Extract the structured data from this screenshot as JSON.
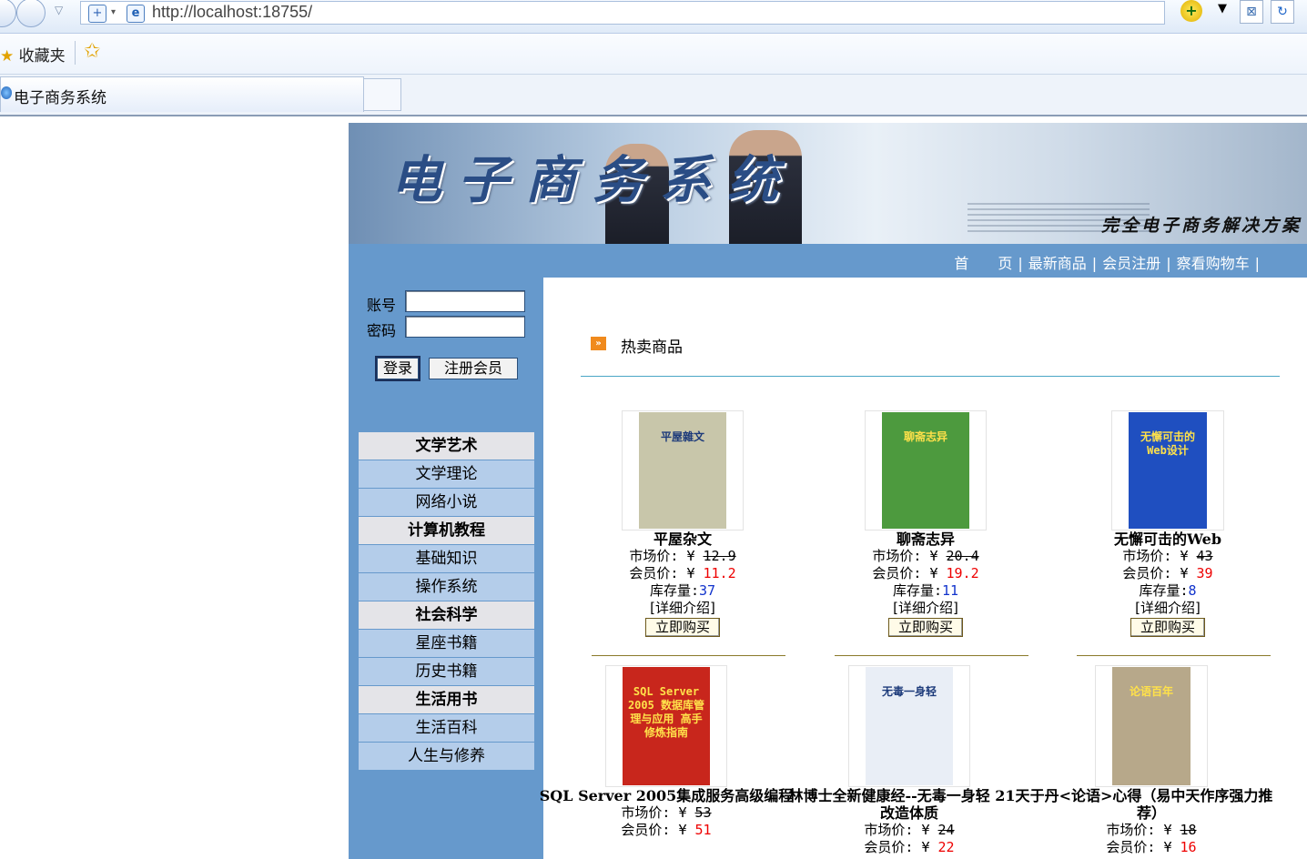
{
  "browser": {
    "url": "http://localhost:18755/",
    "favorites_label": "收藏夹",
    "tab_title": "电子商务系统"
  },
  "banner": {
    "title": "电子商务系统",
    "slogan": "完全电子商务解决方案"
  },
  "nav": {
    "items": [
      "首　　页",
      "最新商品",
      "会员注册",
      "察看购物车"
    ],
    "separator": "|"
  },
  "login": {
    "account_label": "账号",
    "password_label": "密码",
    "login_button": "登录",
    "register_button": "注册会员"
  },
  "categories": [
    {
      "label": "文学艺术",
      "type": "head"
    },
    {
      "label": "文学理论",
      "type": "sub"
    },
    {
      "label": "网络小说",
      "type": "sub"
    },
    {
      "label": "计算机教程",
      "type": "head"
    },
    {
      "label": "基础知识",
      "type": "sub"
    },
    {
      "label": "操作系统",
      "type": "sub"
    },
    {
      "label": "社会科学",
      "type": "head"
    },
    {
      "label": "星座书籍",
      "type": "sub"
    },
    {
      "label": "历史书籍",
      "type": "sub"
    },
    {
      "label": "生活用书",
      "type": "head"
    },
    {
      "label": "生活百科",
      "type": "sub"
    },
    {
      "label": "人生与修养",
      "type": "sub"
    }
  ],
  "section_title": "热卖商品",
  "labels": {
    "market_price": "市场价:",
    "member_price": "会员价:",
    "stock": "库存量:",
    "currency": "¥",
    "detail": "[详细介绍]",
    "buy": "立即购买"
  },
  "products": [
    {
      "name": "平屋杂文",
      "market_price": "12.9",
      "member_price": "11.2",
      "stock": "37",
      "cover_text": "平屋雜文",
      "cover_color": "#c8c6aa"
    },
    {
      "name": "聊斋志异",
      "market_price": "20.4",
      "member_price": "19.2",
      "stock": "11",
      "cover_text": "聊斋志异",
      "cover_color": "#4d9a3e"
    },
    {
      "name": "无懈可击的Web",
      "market_price": "43",
      "member_price": "39",
      "stock": "8",
      "cover_text": "无懈可击的Web设计",
      "cover_color": "#1f4fc0"
    },
    {
      "name": "SQL Server 2005集成服务高级编程",
      "market_price": "53",
      "member_price": "51",
      "stock": "",
      "cover_text": "SQL Server 2005 数据库管理与应用 高手修炼指南",
      "cover_color": "#c8261c"
    },
    {
      "name": "林博士全新健康经--无毒一身轻 21天改造体质",
      "market_price": "24",
      "member_price": "22",
      "stock": "",
      "cover_text": "无毒一身轻",
      "cover_color": "#e9eef6"
    },
    {
      "name": "于丹<论语>心得（易中天作序强力推荐）",
      "market_price": "18",
      "member_price": "16",
      "stock": "",
      "cover_text": "论语百年",
      "cover_color": "#b7a88a"
    }
  ]
}
